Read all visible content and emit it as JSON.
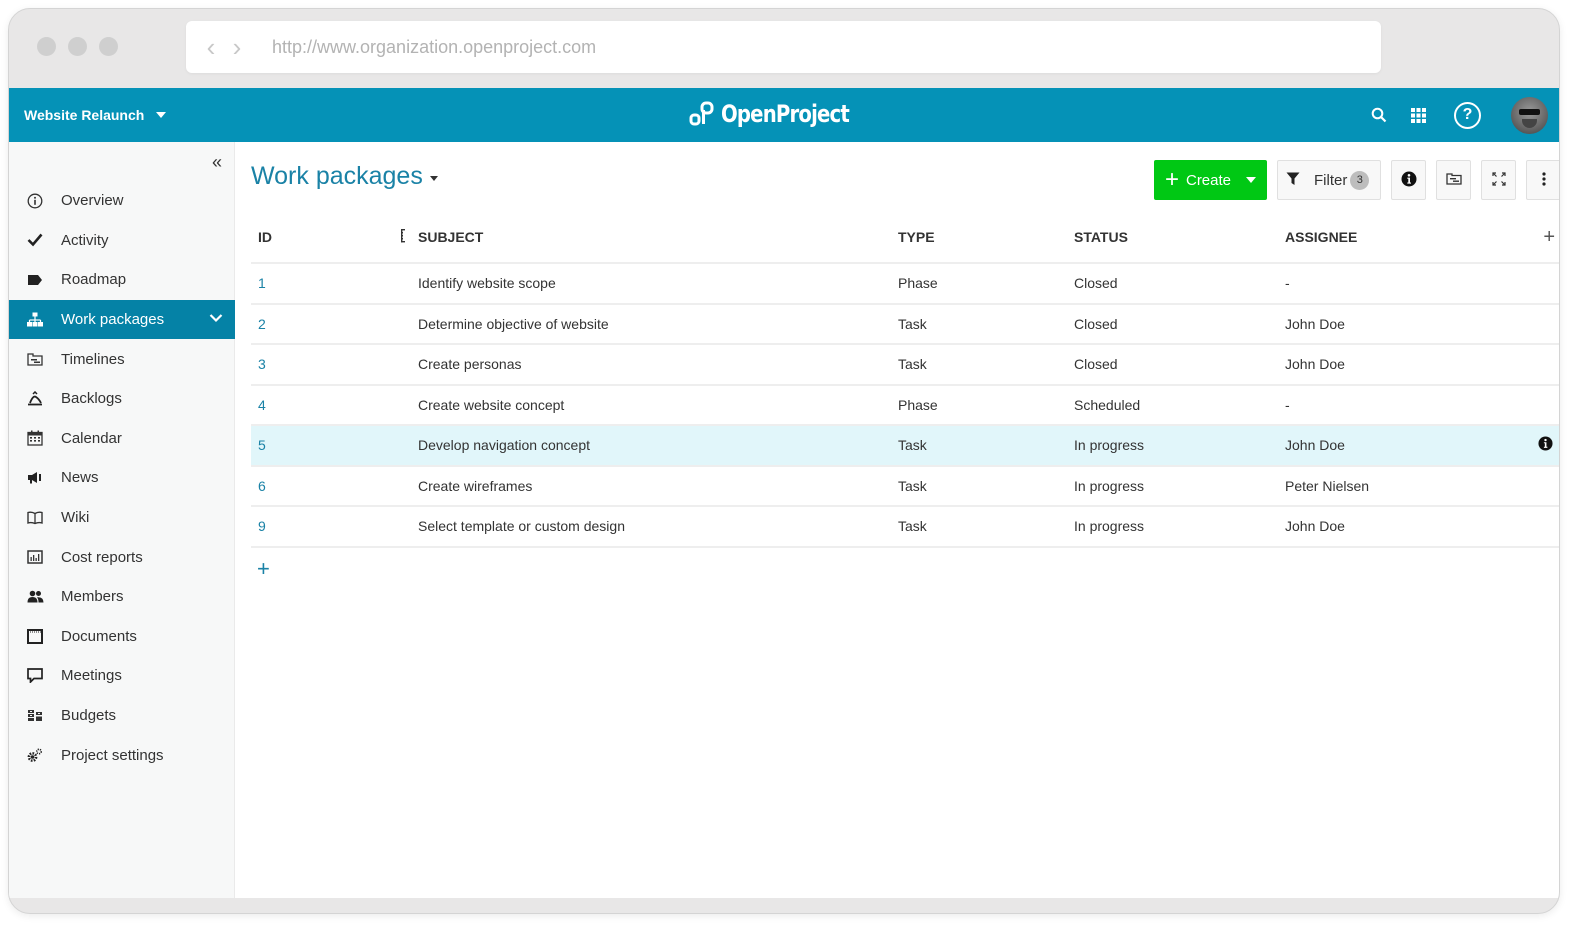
{
  "browser": {
    "url": "http://www.organization.openproject.com",
    "back_icon": "chevron-left-icon",
    "forward_icon": "chevron-right-icon"
  },
  "topbar": {
    "project": "Website Relaunch",
    "logo_text": "OpenProject",
    "help_label": "?",
    "icons": [
      "search-icon",
      "modules-grid-icon",
      "help-icon",
      "user-avatar"
    ]
  },
  "sidebar": {
    "collapse_label": "«",
    "items": [
      {
        "label": "Overview",
        "icon": "info-circle-icon"
      },
      {
        "label": "Activity",
        "icon": "checkmark-icon"
      },
      {
        "label": "Roadmap",
        "icon": "tag-icon"
      },
      {
        "label": "Work packages",
        "icon": "hierarchy-icon",
        "active": true
      },
      {
        "label": "Timelines",
        "icon": "timeline-icon"
      },
      {
        "label": "Backlogs",
        "icon": "backlogs-icon"
      },
      {
        "label": "Calendar",
        "icon": "calendar-icon"
      },
      {
        "label": "News",
        "icon": "megaphone-icon"
      },
      {
        "label": "Wiki",
        "icon": "book-icon"
      },
      {
        "label": "Cost reports",
        "icon": "chart-icon"
      },
      {
        "label": "Members",
        "icon": "group-icon"
      },
      {
        "label": "Documents",
        "icon": "document-icon"
      },
      {
        "label": "Meetings",
        "icon": "speech-bubble-icon"
      },
      {
        "label": "Budgets",
        "icon": "budget-icon"
      },
      {
        "label": "Project settings",
        "icon": "gears-icon"
      }
    ]
  },
  "main": {
    "title": "Work packages",
    "toolbar": {
      "create_label": "Create",
      "filter_label": "Filter",
      "filter_count": "3"
    },
    "table": {
      "columns": [
        "ID",
        "SUBJECT",
        "TYPE",
        "STATUS",
        "ASSIGNEE"
      ],
      "rows": [
        {
          "id": "1",
          "subject": "Identify website scope",
          "type": "Phase",
          "status": "Closed",
          "assignee": "-"
        },
        {
          "id": "2",
          "subject": "Determine objective of website",
          "type": "Task",
          "status": "Closed",
          "assignee": "John Doe"
        },
        {
          "id": "3",
          "subject": "Create personas",
          "type": "Task",
          "status": "Closed",
          "assignee": "John Doe"
        },
        {
          "id": "4",
          "subject": "Create website concept",
          "type": "Phase",
          "status": "Scheduled",
          "assignee": "-"
        },
        {
          "id": "5",
          "subject": "Develop navigation concept",
          "type": "Task",
          "status": "In progress",
          "assignee": "John Doe",
          "highlighted": true
        },
        {
          "id": "6",
          "subject": "Create wireframes",
          "type": "Task",
          "status": "In progress",
          "assignee": "Peter Nielsen"
        },
        {
          "id": "9",
          "subject": "Select template or custom design",
          "type": "Task",
          "status": "In progress",
          "assignee": "John Doe"
        }
      ],
      "add_column_label": "+",
      "add_row_label": "+"
    }
  },
  "colors": {
    "header": "#0592b7",
    "active_menu": "#0582a6",
    "create_button": "#00c814",
    "link": "#1a82a6",
    "row_highlight": "#e1f6fa"
  }
}
